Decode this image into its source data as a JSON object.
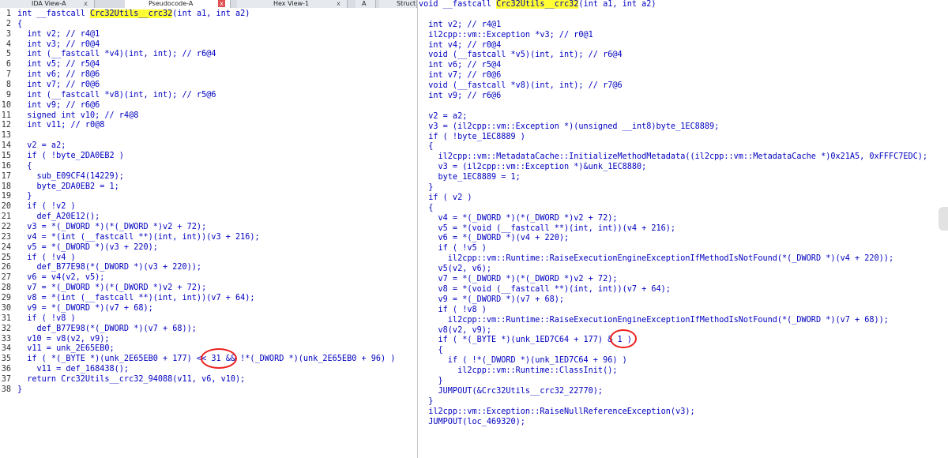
{
  "tabs": [
    {
      "label": "IDA View-A",
      "active": false,
      "close": "x"
    },
    {
      "label": "Pseudocode-A",
      "active": true,
      "close": "x"
    },
    {
      "label": "Hex View-1",
      "active": false,
      "close": "x"
    },
    {
      "label": "A",
      "active": false,
      "close": ""
    },
    {
      "label": "Struct",
      "active": false,
      "close": ""
    }
  ],
  "left_lines": [
    {
      "n": "1",
      "t": "int __fastcall ",
      "h": "Crc32Utils__crc32",
      "r": "(int a1, int a2)"
    },
    {
      "n": "2",
      "t": "{"
    },
    {
      "n": "3",
      "t": "  int v2; // r4@1"
    },
    {
      "n": "4",
      "t": "  int v3; // r0@4"
    },
    {
      "n": "5",
      "t": "  int (__fastcall *v4)(int, int); // r6@4"
    },
    {
      "n": "6",
      "t": "  int v5; // r5@4"
    },
    {
      "n": "7",
      "t": "  int v6; // r8@6"
    },
    {
      "n": "8",
      "t": "  int v7; // r0@6"
    },
    {
      "n": "9",
      "t": "  int (__fastcall *v8)(int, int); // r5@6"
    },
    {
      "n": "10",
      "t": "  int v9; // r6@6"
    },
    {
      "n": "11",
      "t": "  signed int v10; // r4@8"
    },
    {
      "n": "12",
      "t": "  int v11; // r0@8"
    },
    {
      "n": "13",
      "t": ""
    },
    {
      "n": "14",
      "t": "  v2 = a2;"
    },
    {
      "n": "15",
      "t": "  if ( !byte_2DA0EB2 )"
    },
    {
      "n": "16",
      "t": "  {"
    },
    {
      "n": "17",
      "t": "    sub_E09CF4(14229);"
    },
    {
      "n": "18",
      "t": "    byte_2DA0EB2 = 1;"
    },
    {
      "n": "19",
      "t": "  }"
    },
    {
      "n": "20",
      "t": "  if ( !v2 )"
    },
    {
      "n": "21",
      "t": "    def_A20E12();"
    },
    {
      "n": "22",
      "t": "  v3 = *(_DWORD *)(*(_DWORD *)v2 + 72);"
    },
    {
      "n": "23",
      "t": "  v4 = *(int (__fastcall **)(int, int))(v3 + 216);"
    },
    {
      "n": "24",
      "t": "  v5 = *(_DWORD *)(v3 + 220);"
    },
    {
      "n": "25",
      "t": "  if ( !v4 )"
    },
    {
      "n": "26",
      "t": "    def_B77E98(*(_DWORD *)(v3 + 220));"
    },
    {
      "n": "27",
      "t": "  v6 = v4(v2, v5);"
    },
    {
      "n": "28",
      "t": "  v7 = *(_DWORD *)(*(_DWORD *)v2 + 72);"
    },
    {
      "n": "29",
      "t": "  v8 = *(int (__fastcall **)(int, int))(v7 + 64);"
    },
    {
      "n": "30",
      "t": "  v9 = *(_DWORD *)(v7 + 68);"
    },
    {
      "n": "31",
      "t": "  if ( !v8 )"
    },
    {
      "n": "32",
      "t": "    def_B77E98(*(_DWORD *)(v7 + 68));"
    },
    {
      "n": "33",
      "t": "  v10 = v8(v2, v9);"
    },
    {
      "n": "34",
      "t": "  v11 = unk_2E65EB0;"
    },
    {
      "n": "35",
      "t": "  if ( *(_BYTE *)(unk_2E65EB0 + 177) << 31 && !*(_DWORD *)(unk_2E65EB0 + 96) )"
    },
    {
      "n": "36",
      "t": "    v11 = def_168438();"
    },
    {
      "n": "37",
      "t": "  return Crc32Utils__crc32_94088(v11, v6, v10);"
    },
    {
      "n": "38",
      "t": "}"
    }
  ],
  "right_lines": [
    {
      "t": "void __fastcall ",
      "h": "Crc32Utils__crc32",
      "r": "(int a1, int a2)"
    },
    {
      "t": ""
    },
    {
      "t": "  int v2; // r4@1"
    },
    {
      "t": "  il2cpp::vm::Exception *v3; // r0@1"
    },
    {
      "t": "  int v4; // r0@4"
    },
    {
      "t": "  void (__fastcall *v5)(int, int); // r6@4"
    },
    {
      "t": "  int v6; // r5@4"
    },
    {
      "t": "  int v7; // r0@6"
    },
    {
      "t": "  void (__fastcall *v8)(int, int); // r7@6"
    },
    {
      "t": "  int v9; // r6@6"
    },
    {
      "t": ""
    },
    {
      "t": "  v2 = a2;"
    },
    {
      "t": "  v3 = (il2cpp::vm::Exception *)(unsigned __int8)byte_1EC8889;"
    },
    {
      "t": "  if ( !byte_1EC8889 )"
    },
    {
      "t": "  {"
    },
    {
      "t": "    il2cpp::vm::MetadataCache::InitializeMethodMetadata((il2cpp::vm::MetadataCache *)0x21A5, 0xFFFC7EDC);"
    },
    {
      "t": "    v3 = (il2cpp::vm::Exception *)&unk_1EC8880;"
    },
    {
      "t": "    byte_1EC8889 = 1;"
    },
    {
      "t": "  }"
    },
    {
      "t": "  if ( v2 )"
    },
    {
      "t": "  {"
    },
    {
      "t": "    v4 = *(_DWORD *)(*(_DWORD *)v2 + 72);"
    },
    {
      "t": "    v5 = *(void (__fastcall **)(int, int))(v4 + 216);"
    },
    {
      "t": "    v6 = *(_DWORD *)(v4 + 220);"
    },
    {
      "t": "    if ( !v5 )"
    },
    {
      "t": "      il2cpp::vm::Runtime::RaiseExecutionEngineExceptionIfMethodIsNotFound(*(_DWORD *)(v4 + 220));"
    },
    {
      "t": "    v5(v2, v6);"
    },
    {
      "t": "    v7 = *(_DWORD *)(*(_DWORD *)v2 + 72);"
    },
    {
      "t": "    v8 = *(void (__fastcall **)(int, int))(v7 + 64);"
    },
    {
      "t": "    v9 = *(_DWORD *)(v7 + 68);"
    },
    {
      "t": "    if ( !v8 )"
    },
    {
      "t": "      il2cpp::vm::Runtime::RaiseExecutionEngineExceptionIfMethodIsNotFound(*(_DWORD *)(v7 + 68));"
    },
    {
      "t": "    v8(v2, v9);"
    },
    {
      "t": "    if ( *(_BYTE *)(unk_1ED7C64 + 177) & 1 )"
    },
    {
      "t": "    {"
    },
    {
      "t": "      if ( !*(_DWORD *)(unk_1ED7C64 + 96) )"
    },
    {
      "t": "        il2cpp::vm::Runtime::ClassInit();"
    },
    {
      "t": "    }"
    },
    {
      "t": "    JUMPOUT(&Crc32Utils__crc32_22770);"
    },
    {
      "t": "  }"
    },
    {
      "t": "  il2cpp::vm::Exception::RaiseNullReferenceException(v3);"
    },
    {
      "t": "  JUMPOUT(loc_469320);"
    }
  ]
}
